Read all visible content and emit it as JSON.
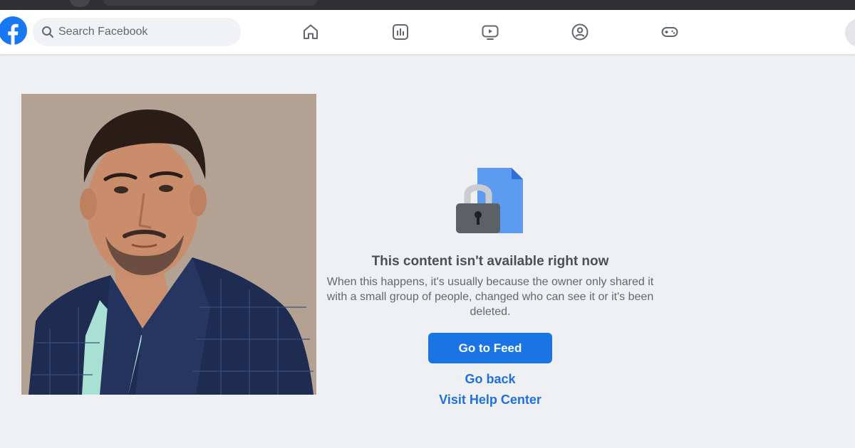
{
  "topbar": {
    "search_placeholder": "Search Facebook",
    "nav": [
      "home-icon",
      "news-feed-icon",
      "watch-video-icon",
      "groups-icon",
      "gaming-icon"
    ]
  },
  "message": {
    "title": "This content isn't available right now",
    "description": "When this happens, it's usually because the owner only shared it with a small group of people, changed who can see it or it's been deleted.",
    "go_to_feed": "Go to Feed",
    "go_back": "Go back",
    "help_center": "Visit Help Center"
  },
  "colors": {
    "brand": "#1877f2",
    "button": "#1b74e4",
    "link": "#216fdb",
    "page_background": "#eef0f4"
  }
}
